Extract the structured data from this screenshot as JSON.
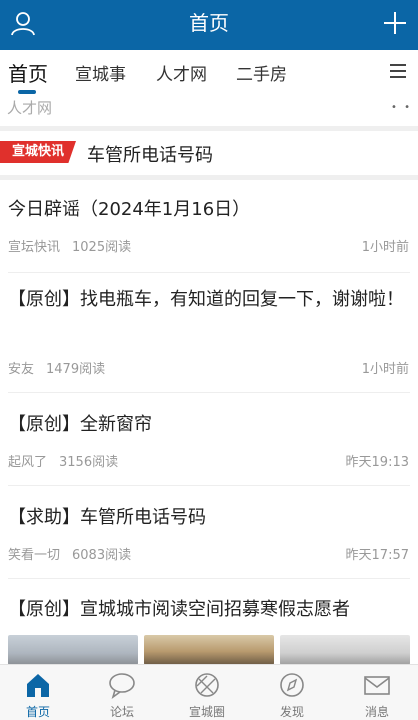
{
  "header": {
    "title": "首页",
    "accent": "#0b66a6"
  },
  "tabs": [
    {
      "label": "首页",
      "active": true
    },
    {
      "label": "宣城事",
      "active": false
    },
    {
      "label": "人才网",
      "active": false
    },
    {
      "label": "二手房",
      "active": false
    }
  ],
  "subbar": {
    "label": "人才网",
    "indicator": "• •"
  },
  "flash": {
    "badge": "宣城快讯",
    "headline": "车管所电话号码",
    "badge_color": "#e0302c"
  },
  "feed": [
    {
      "title": "今日辟谣（2024年1月16日）",
      "source": "宣坛快讯",
      "reads": "1025阅读",
      "time": "1小时前"
    },
    {
      "title": "【原创】找电瓶车，有知道的回复一下，谢谢啦！",
      "source": "安友",
      "reads": "1479阅读",
      "time": "1小时前"
    },
    {
      "title": "【原创】全新窗帘",
      "source": "起风了",
      "reads": "3156阅读",
      "time": "昨天19:13"
    },
    {
      "title": "【求助】车管所电话号码",
      "source": "笑看一切",
      "reads": "6083阅读",
      "time": "昨天17:57"
    },
    {
      "title": "【原创】宣城城市阅读空间招募寒假志愿者"
    }
  ],
  "bottom_nav": [
    {
      "label": "首页",
      "icon": "home-icon",
      "active": true
    },
    {
      "label": "论坛",
      "icon": "chat-bubble-icon",
      "active": false
    },
    {
      "label": "宣城圈",
      "icon": "circle-aperture-icon",
      "active": false
    },
    {
      "label": "发现",
      "icon": "compass-icon",
      "active": false
    },
    {
      "label": "消息",
      "icon": "mail-icon",
      "active": false
    }
  ]
}
